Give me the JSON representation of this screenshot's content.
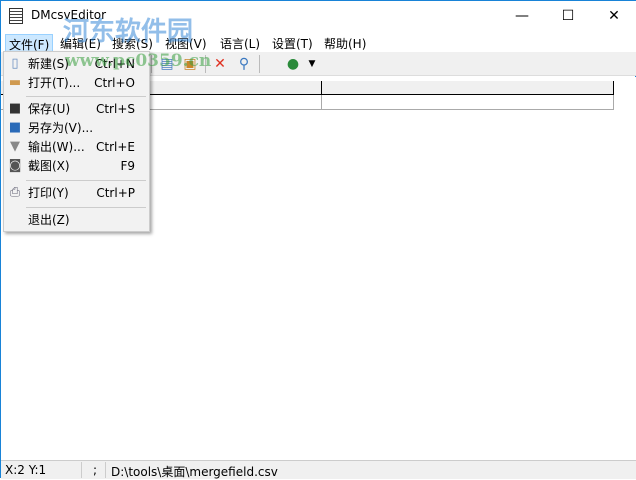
{
  "window": {
    "title": "DMcsvEditor",
    "minimize": "—",
    "maximize": "☐",
    "close": "✕"
  },
  "menubar": [
    {
      "label": "文件(F)"
    },
    {
      "label": "编辑(E)"
    },
    {
      "label": "搜索(S)"
    },
    {
      "label": "视图(V)"
    },
    {
      "label": "语言(L)"
    },
    {
      "label": "设置(T)"
    },
    {
      "label": "帮助(H)"
    }
  ],
  "file_menu": [
    {
      "label": "新建(S)",
      "shortcut": "Ctrl+N",
      "icon": "new-file-icon"
    },
    {
      "label": "打开(T)...",
      "shortcut": "Ctrl+O",
      "icon": "folder-icon"
    },
    {
      "label": "保存(U)",
      "shortcut": "Ctrl+S",
      "icon": "save-icon"
    },
    {
      "label": "另存为(V)...",
      "shortcut": "",
      "icon": "save-as-icon"
    },
    {
      "label": "输出(W)...",
      "shortcut": "Ctrl+E",
      "icon": "funnel-icon"
    },
    {
      "label": "截图(X)",
      "shortcut": "F9",
      "icon": "camera-icon"
    },
    {
      "label": "打印(Y)",
      "shortcut": "Ctrl+P",
      "icon": "printer-icon"
    },
    {
      "label": "退出(Z)",
      "shortcut": "",
      "icon": ""
    }
  ],
  "status": {
    "position": "X:2  Y:1",
    "separator": ";",
    "path": "D:\\tools\\桌面\\mergefield.csv"
  },
  "watermark": {
    "name": "河东软件园",
    "url": "www.pc0359.cn"
  }
}
